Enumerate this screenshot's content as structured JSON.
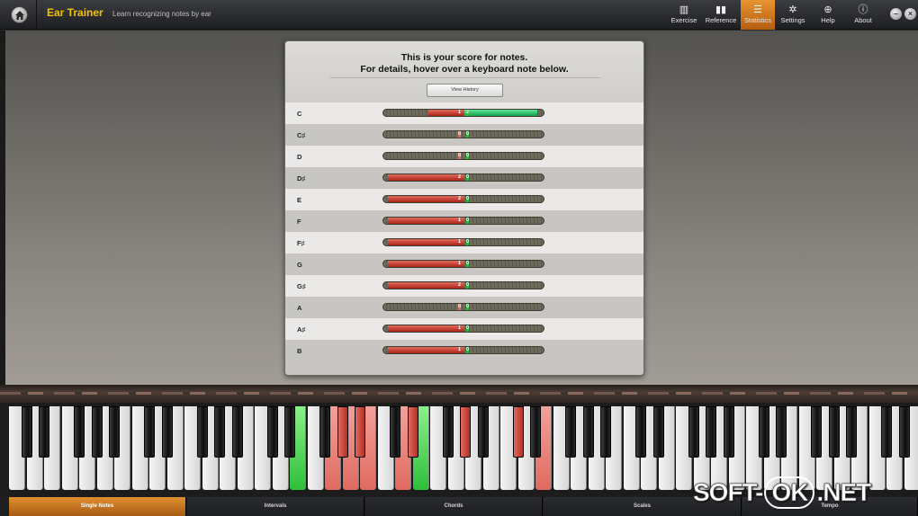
{
  "app": {
    "title": "Ear Trainer",
    "subtitle": "Learn recognizing notes by ear"
  },
  "nav": [
    {
      "label": "Exercise",
      "icon": "piano-keys-icon"
    },
    {
      "label": "Reference",
      "icon": "book-icon"
    },
    {
      "label": "Statistics",
      "icon": "list-icon",
      "active": true
    },
    {
      "label": "Settings",
      "icon": "gear-icon"
    },
    {
      "label": "Help",
      "icon": "lifebuoy-icon"
    },
    {
      "label": "About",
      "icon": "info-icon"
    }
  ],
  "score": {
    "heading_line1": "This is your score for notes.",
    "heading_line2": "For details, hover over a keyboard note below.",
    "history_button": "View History",
    "notes": [
      {
        "name": "C",
        "wrong": "1",
        "right": "2",
        "wrong_frac": 0.45,
        "right_frac": 0.9
      },
      {
        "name": "C♯",
        "wrong": "0",
        "right": "0",
        "wrong_frac": 0.0,
        "right_frac": 0.0
      },
      {
        "name": "D",
        "wrong": "0",
        "right": "0",
        "wrong_frac": 0.0,
        "right_frac": 0.0
      },
      {
        "name": "D♯",
        "wrong": "2",
        "right": "0",
        "wrong_frac": 0.95,
        "right_frac": 0.0
      },
      {
        "name": "E",
        "wrong": "2",
        "right": "0",
        "wrong_frac": 0.95,
        "right_frac": 0.0
      },
      {
        "name": "F",
        "wrong": "1",
        "right": "0",
        "wrong_frac": 0.95,
        "right_frac": 0.0
      },
      {
        "name": "F♯",
        "wrong": "1",
        "right": "0",
        "wrong_frac": 0.95,
        "right_frac": 0.0
      },
      {
        "name": "G",
        "wrong": "1",
        "right": "0",
        "wrong_frac": 0.95,
        "right_frac": 0.0
      },
      {
        "name": "G♯",
        "wrong": "2",
        "right": "0",
        "wrong_frac": 0.95,
        "right_frac": 0.0
      },
      {
        "name": "A",
        "wrong": "0",
        "right": "0",
        "wrong_frac": 0.0,
        "right_frac": 0.0
      },
      {
        "name": "A♯",
        "wrong": "1",
        "right": "0",
        "wrong_frac": 0.95,
        "right_frac": 0.0
      },
      {
        "name": "B",
        "wrong": "1",
        "right": "0",
        "wrong_frac": 0.95,
        "right_frac": 0.0
      }
    ]
  },
  "bottom_tabs": [
    {
      "label": "Single Notes",
      "active": true
    },
    {
      "label": "Intervals"
    },
    {
      "label": "Chords"
    },
    {
      "label": "Scales"
    },
    {
      "label": "Tempo"
    }
  ],
  "watermark": {
    "text_left": "SOFT-",
    "text_mid": "OK",
    "text_right": ".NET"
  },
  "colors": {
    "accent": "#e08f2c",
    "title": "#f2c200",
    "correct": "#2fbf3a",
    "wrong": "#e06a60"
  }
}
